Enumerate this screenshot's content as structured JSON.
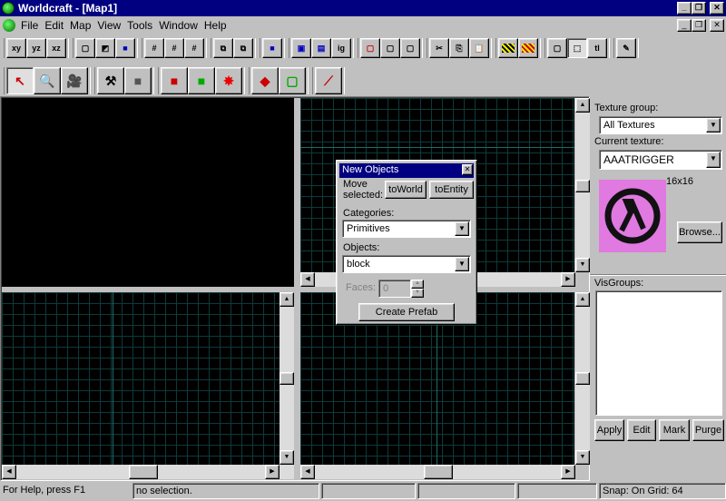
{
  "app": {
    "title": "Worldcraft - [Map1]"
  },
  "menu": [
    "File",
    "Edit",
    "Map",
    "View",
    "Tools",
    "Window",
    "Help"
  ],
  "toolbar1": {
    "view_buttons": [
      "xy",
      "yz",
      "xz"
    ],
    "carve_label": "ig",
    "tl_label": "tl"
  },
  "dialog": {
    "title": "New Objects",
    "move_selected_label": "Move selected:",
    "to_world": "toWorld",
    "to_entity": "toEntity",
    "categories_label": "Categories:",
    "categories_value": "Primitives",
    "objects_label": "Objects:",
    "objects_value": "block",
    "faces_label": "Faces:",
    "faces_value": "0",
    "create_prefab": "Create Prefab"
  },
  "texture_panel": {
    "group_label": "Texture group:",
    "group_value": "All Textures",
    "current_label": "Current texture:",
    "current_value": "AAATRIGGER",
    "size": "16x16",
    "browse": "Browse...",
    "visgroups_label": "VisGroups:",
    "apply": "Apply",
    "edit": "Edit",
    "mark": "Mark",
    "purge": "Purge",
    "texture_color": "#e079e0"
  },
  "status": {
    "help": "For Help, press F1",
    "selection": "no selection.",
    "snap": "Snap: On Grid: 64"
  },
  "colors": {
    "titlebar": "#000080",
    "grid_line": "#0e3a3a",
    "grid_axis": "#1e6a6a"
  }
}
